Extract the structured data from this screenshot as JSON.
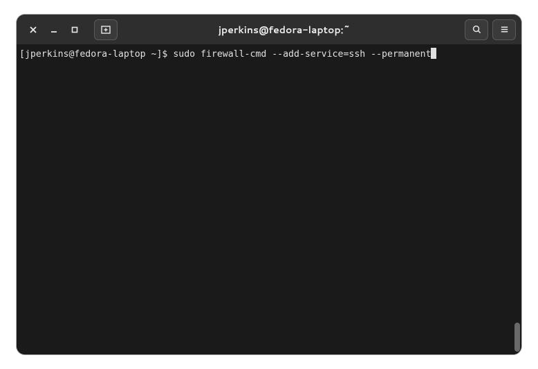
{
  "window": {
    "title": "jperkins@fedora-laptop:~"
  },
  "terminal": {
    "prompt": "[jperkins@fedora-laptop ~]$ ",
    "command": "sudo firewall-cmd --add-service=ssh --permanent"
  }
}
